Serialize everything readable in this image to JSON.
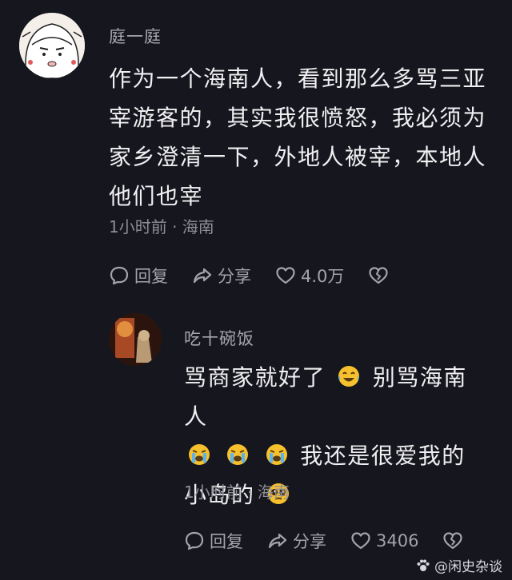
{
  "comments": [
    {
      "username": "庭一庭",
      "text": "作为一个海南人，看到那么多骂三亚宰游客的，其实我很愤怒，我必须为家乡澄清一下，外地人被宰，本地人他们也宰",
      "meta": "1小时前 · 海南",
      "reply_label": "回复",
      "share_label": "分享",
      "like_count": "4.0万"
    },
    {
      "username": "吃十碗饭",
      "text_parts": [
        "骂商家就好了",
        "别骂海南人",
        "我还是很爱我的小岛的"
      ],
      "meta": "1小时前 · 海南",
      "reply_label": "回复",
      "share_label": "分享",
      "like_count": "3406"
    }
  ],
  "watermark": "@闲史杂谈",
  "icons": {
    "reply": "comment-bubble-icon",
    "share": "share-arrow-icon",
    "like": "heart-icon",
    "dislike": "broken-heart-icon",
    "laugh_cry": "laughing-tears-emoji",
    "cry": "crying-emoji",
    "pleading": "pleading-face-emoji"
  }
}
